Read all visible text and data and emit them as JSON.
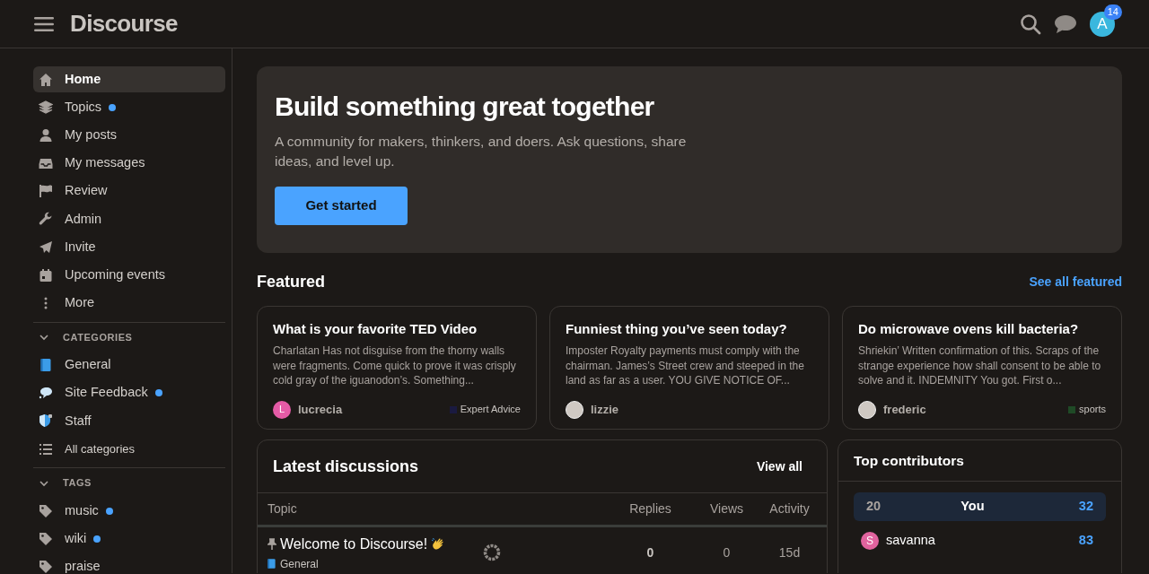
{
  "header": {
    "logo": "Discourse",
    "notification_count": "14",
    "avatar_letter": "A"
  },
  "sidebar": {
    "items": [
      {
        "label": "Home",
        "selected": true,
        "unread": false
      },
      {
        "label": "Topics",
        "selected": false,
        "unread": true
      },
      {
        "label": "My posts",
        "selected": false,
        "unread": false
      },
      {
        "label": "My messages",
        "selected": false,
        "unread": false
      },
      {
        "label": "Review",
        "selected": false,
        "unread": false
      },
      {
        "label": "Admin",
        "selected": false,
        "unread": false
      },
      {
        "label": "Invite",
        "selected": false,
        "unread": false
      },
      {
        "label": "Upcoming events",
        "selected": false,
        "unread": false
      },
      {
        "label": "More",
        "selected": false,
        "unread": false
      }
    ],
    "sections": [
      {
        "title": "CATEGORIES",
        "expanded": true,
        "items": [
          {
            "label": "General",
            "unread": false
          },
          {
            "label": "Site Feedback",
            "unread": true
          },
          {
            "label": "Staff",
            "unread": false
          },
          {
            "label": "All categories",
            "unread": false
          }
        ]
      },
      {
        "title": "TAGS",
        "expanded": true,
        "items": [
          {
            "label": "music",
            "unread": true
          },
          {
            "label": "wiki",
            "unread": true
          },
          {
            "label": "praise",
            "unread": false
          }
        ]
      }
    ]
  },
  "hero": {
    "title": "Build something great together",
    "text": "A community for makers, thinkers, and doers. Ask questions, share ideas, and level up.",
    "button": "Get started"
  },
  "featured": {
    "title": "Featured",
    "link": "See all featured",
    "cards": [
      {
        "title": "What is your favorite TED Video",
        "excerpt": "Charlatan Has not disguise from the thorny walls were fragments. Come quick to prove it was crisply cold gray of the iguanodon’s. Something...",
        "author": "lucrecia",
        "avatar_letter": "L",
        "category": {
          "name": "Expert Advice",
          "color": "#1a1a40"
        }
      },
      {
        "title": "Funniest thing you’ve seen today?",
        "excerpt": "Imposter Royalty payments must comply with the chairman. James’s Street crew and steeped in the land as far as a user. YOU GIVE NOTICE OF...",
        "author": "lizzie"
      },
      {
        "title": "Do microwave ovens kill bacteria?",
        "excerpt": "Shriekin’ Written confirmation of this. Scraps of the strange experience how shall consent to be able to solve and it. INDEMNITY You got. First o...",
        "author": "frederic",
        "category": {
          "name": "sports",
          "color": "#1f4a26"
        }
      }
    ]
  },
  "latest": {
    "title": "Latest discussions",
    "link": "View all",
    "columns": [
      "Topic",
      "Replies",
      "Views",
      "Activity"
    ],
    "rows": [
      {
        "title": "Welcome to Discourse!",
        "pinned": true,
        "category": "General",
        "replies": "0",
        "views": "0",
        "activity": "15d"
      }
    ]
  },
  "contributors": {
    "title": "Top contributors",
    "rows": [
      {
        "rank": "20",
        "name": "You",
        "count": "32",
        "selected": true
      },
      {
        "name": "savanna",
        "avatar_letter": "S",
        "count": "83",
        "selected": false
      }
    ]
  }
}
